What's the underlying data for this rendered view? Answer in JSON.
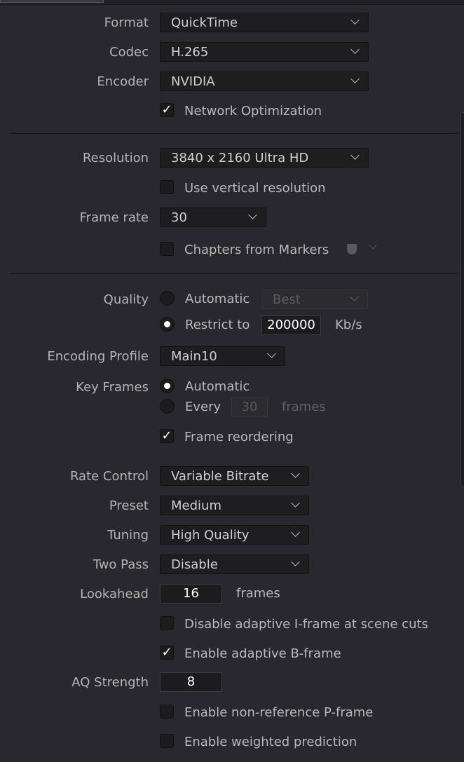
{
  "format": {
    "label": "Format",
    "value": "QuickTime"
  },
  "codec": {
    "label": "Codec",
    "value": "H.265"
  },
  "encoder": {
    "label": "Encoder",
    "value": "NVIDIA"
  },
  "network_optimization": {
    "label": "Network Optimization",
    "checked": true
  },
  "resolution": {
    "label": "Resolution",
    "value": "3840 x 2160 Ultra HD"
  },
  "vertical_resolution": {
    "label": "Use vertical resolution",
    "checked": false
  },
  "frame_rate": {
    "label": "Frame rate",
    "value": "30"
  },
  "chapters": {
    "label": "Chapters from Markers",
    "checked": false
  },
  "quality": {
    "label": "Quality",
    "automatic": "Automatic",
    "best": "Best",
    "restrict": "Restrict to",
    "bitrate": "200000",
    "unit": "Kb/s",
    "selected": "Restrict to"
  },
  "encoding_profile": {
    "label": "Encoding Profile",
    "value": "Main10"
  },
  "key_frames": {
    "label": "Key Frames",
    "automatic": "Automatic",
    "every": "Every",
    "every_value": "30",
    "frames": "frames",
    "selected": "Automatic"
  },
  "frame_reordering": {
    "label": "Frame reordering",
    "checked": true
  },
  "rate_control": {
    "label": "Rate Control",
    "value": "Variable Bitrate"
  },
  "preset": {
    "label": "Preset",
    "value": "Medium"
  },
  "tuning": {
    "label": "Tuning",
    "value": "High Quality"
  },
  "two_pass": {
    "label": "Two Pass",
    "value": "Disable"
  },
  "lookahead": {
    "label": "Lookahead",
    "value": "16",
    "unit": "frames"
  },
  "adaptive_iframe": {
    "label": "Disable adaptive I-frame at scene cuts",
    "checked": false
  },
  "adaptive_bframe": {
    "label": "Enable adaptive B-frame",
    "checked": true
  },
  "aq_strength": {
    "label": "AQ Strength",
    "value": "8"
  },
  "nonref_pframe": {
    "label": "Enable non-reference P-frame",
    "checked": false
  },
  "weighted_prediction": {
    "label": "Enable weighted prediction",
    "checked": false
  },
  "check_mark": "✓"
}
